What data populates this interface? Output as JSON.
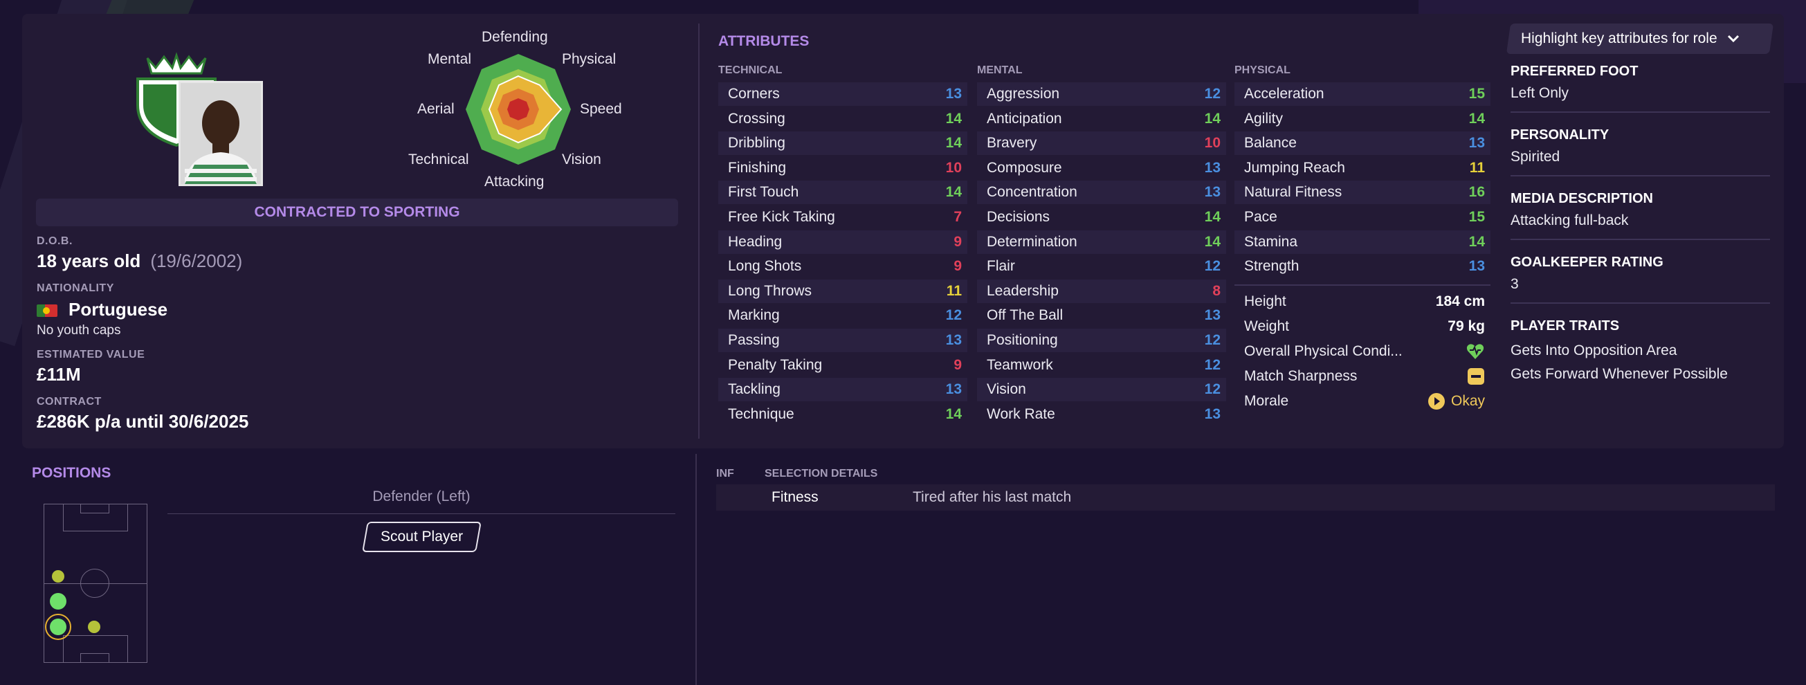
{
  "colors": {
    "accent": "#b48ae8",
    "attr_high": "#6fcf5a",
    "attr_mid": "#4a8fe0",
    "attr_low": "#e0405a",
    "attr_yellow": "#e6d13a",
    "background": "#1b1330",
    "panel": "#231a35"
  },
  "profile": {
    "contract_banner": "CONTRACTED TO SPORTING",
    "dob_label": "D.O.B.",
    "age": "18 years old",
    "dob": "(19/6/2002)",
    "nationality_label": "NATIONALITY",
    "nationality": "Portuguese",
    "youth_caps": "No youth caps",
    "value_label": "ESTIMATED VALUE",
    "value": "£11M",
    "contract_label": "CONTRACT",
    "contract": "£286K p/a until 30/6/2025"
  },
  "radar": {
    "labels": [
      "Defending",
      "Physical",
      "Speed",
      "Vision",
      "Attacking",
      "Technical",
      "Aerial",
      "Mental"
    ]
  },
  "attributes": {
    "title": "ATTRIBUTES",
    "technical": {
      "title": "TECHNICAL",
      "items": [
        {
          "name": "Corners",
          "value": "13"
        },
        {
          "name": "Crossing",
          "value": "14"
        },
        {
          "name": "Dribbling",
          "value": "14"
        },
        {
          "name": "Finishing",
          "value": "10"
        },
        {
          "name": "First Touch",
          "value": "14"
        },
        {
          "name": "Free Kick Taking",
          "value": "7"
        },
        {
          "name": "Heading",
          "value": "9"
        },
        {
          "name": "Long Shots",
          "value": "9"
        },
        {
          "name": "Long Throws",
          "value": "11"
        },
        {
          "name": "Marking",
          "value": "12"
        },
        {
          "name": "Passing",
          "value": "13"
        },
        {
          "name": "Penalty Taking",
          "value": "9"
        },
        {
          "name": "Tackling",
          "value": "13"
        },
        {
          "name": "Technique",
          "value": "14"
        }
      ]
    },
    "mental": {
      "title": "MENTAL",
      "items": [
        {
          "name": "Aggression",
          "value": "12"
        },
        {
          "name": "Anticipation",
          "value": "14"
        },
        {
          "name": "Bravery",
          "value": "10"
        },
        {
          "name": "Composure",
          "value": "13"
        },
        {
          "name": "Concentration",
          "value": "13"
        },
        {
          "name": "Decisions",
          "value": "14"
        },
        {
          "name": "Determination",
          "value": "14"
        },
        {
          "name": "Flair",
          "value": "12"
        },
        {
          "name": "Leadership",
          "value": "8"
        },
        {
          "name": "Off The Ball",
          "value": "13"
        },
        {
          "name": "Positioning",
          "value": "12"
        },
        {
          "name": "Teamwork",
          "value": "12"
        },
        {
          "name": "Vision",
          "value": "12"
        },
        {
          "name": "Work Rate",
          "value": "13"
        }
      ]
    },
    "physical": {
      "title": "PHYSICAL",
      "items": [
        {
          "name": "Acceleration",
          "value": "15"
        },
        {
          "name": "Agility",
          "value": "14"
        },
        {
          "name": "Balance",
          "value": "13"
        },
        {
          "name": "Jumping Reach",
          "value": "11"
        },
        {
          "name": "Natural Fitness",
          "value": "16"
        },
        {
          "name": "Pace",
          "value": "15"
        },
        {
          "name": "Stamina",
          "value": "14"
        },
        {
          "name": "Strength",
          "value": "13"
        }
      ],
      "height_label": "Height",
      "height": "184 cm",
      "weight_label": "Weight",
      "weight": "79 kg",
      "condition_label": "Overall Physical Condi...",
      "sharpness_label": "Match Sharpness",
      "morale_label": "Morale",
      "morale": "Okay"
    }
  },
  "right_panel": {
    "highlight_button": "Highlight key attributes for role",
    "preferred_foot_label": "PREFERRED FOOT",
    "preferred_foot": "Left Only",
    "personality_label": "PERSONALITY",
    "personality": "Spirited",
    "media_label": "MEDIA DESCRIPTION",
    "media": "Attacking full-back",
    "gk_label": "GOALKEEPER RATING",
    "gk": "3",
    "traits_label": "PLAYER TRAITS",
    "traits": [
      "Gets Into Opposition Area",
      "Gets Forward Whenever Possible"
    ]
  },
  "positions": {
    "title": "POSITIONS",
    "heading": "Defender (Left)",
    "scout_button": "Scout Player"
  },
  "selection": {
    "inf_label": "INF",
    "details_label": "SELECTION DETAILS",
    "row_label": "Fitness",
    "row_value": "Tired after his last match"
  }
}
